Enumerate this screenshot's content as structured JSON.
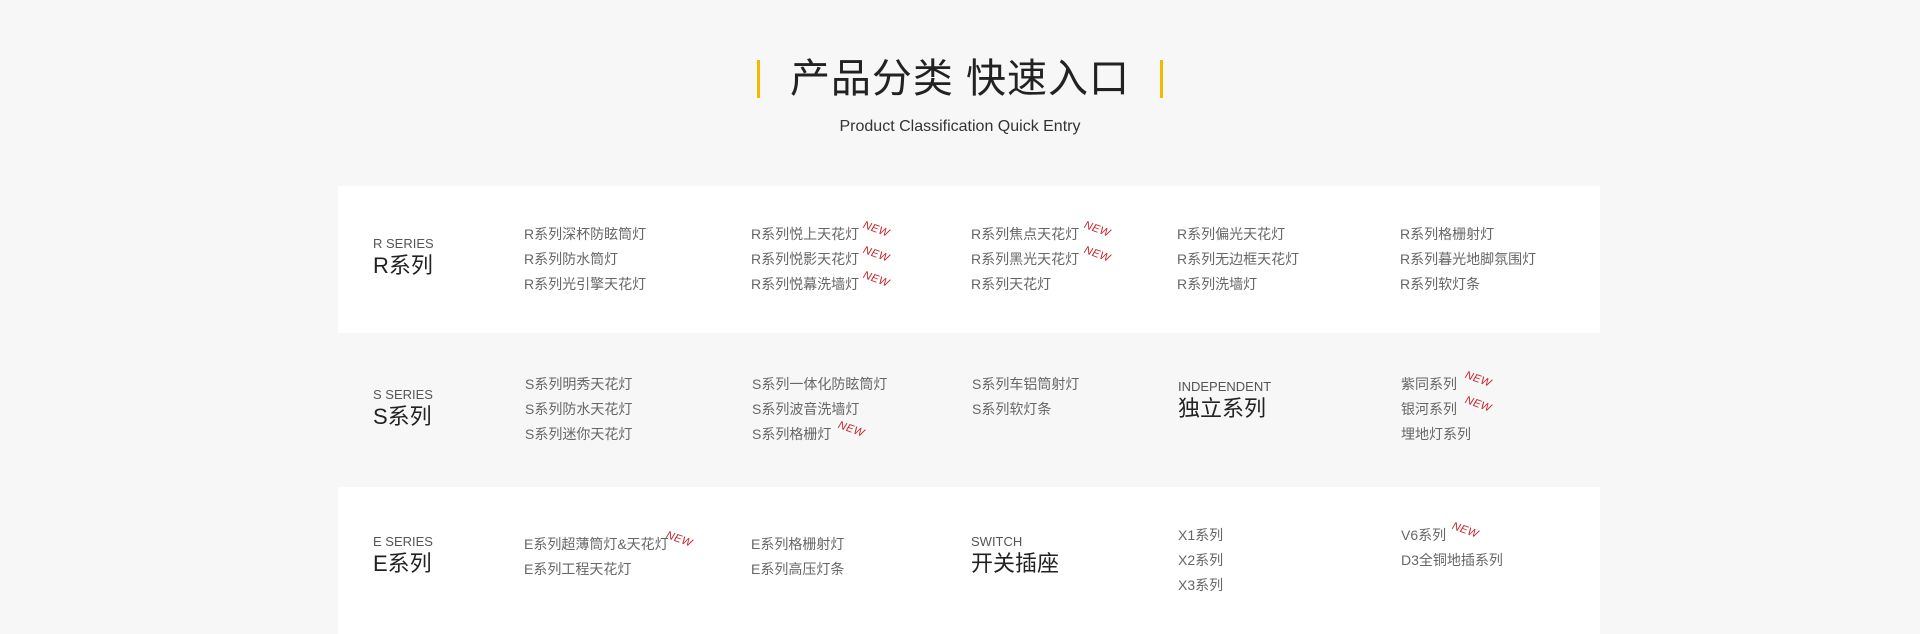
{
  "header": {
    "title": "产品分类 快速入口",
    "subtitle": "Product Classification Quick Entry",
    "accent_color": "#f5b800"
  },
  "new_label": "NEW",
  "sections": {
    "r": {
      "en": "R SERIES",
      "cn": "R系列",
      "columns": [
        [
          "R系列深杯防眩筒灯",
          "R系列防水筒灯",
          "R系列光引擎天花灯"
        ],
        [
          "R系列悦上天花灯",
          "R系列悦影天花灯",
          "R系列悦幕洗墙灯"
        ],
        [
          "R系列焦点天花灯",
          "R系列黑光天花灯",
          "R系列天花灯"
        ],
        [
          "R系列偏光天花灯",
          "R系列无边框天花灯",
          "R系列洗墙灯"
        ],
        [
          "R系列格栅射灯",
          "R系列暮光地脚氛围灯",
          "R系列软灯条"
        ]
      ]
    },
    "s": {
      "en": "S SERIES",
      "cn": "S系列",
      "columns": [
        [
          "S系列明秀天花灯",
          "S系列防水天花灯",
          "S系列迷你天花灯"
        ],
        [
          "S系列一体化防眩筒灯",
          "S系列波音洗墙灯",
          "S系列格栅灯"
        ],
        [
          "S系列车铝筒射灯",
          "S系列软灯条"
        ]
      ],
      "independent": {
        "en": "INDEPENDENT",
        "cn": "独立系列"
      },
      "col5": [
        "紫同系列",
        "银河系列",
        "埋地灯系列"
      ]
    },
    "e": {
      "en": "E SERIES",
      "cn": "E系列",
      "columns": [
        [
          "E系列超薄筒灯&天花灯",
          "E系列工程天花灯"
        ],
        [
          "E系列格栅射灯",
          "E系列高压灯条"
        ]
      ],
      "switch": {
        "en": "SWITCH",
        "cn": "开关插座"
      },
      "col4": [
        "X1系列",
        "X2系列",
        "X3系列"
      ],
      "col5": [
        "V6系列",
        "D3全铜地插系列"
      ]
    }
  }
}
